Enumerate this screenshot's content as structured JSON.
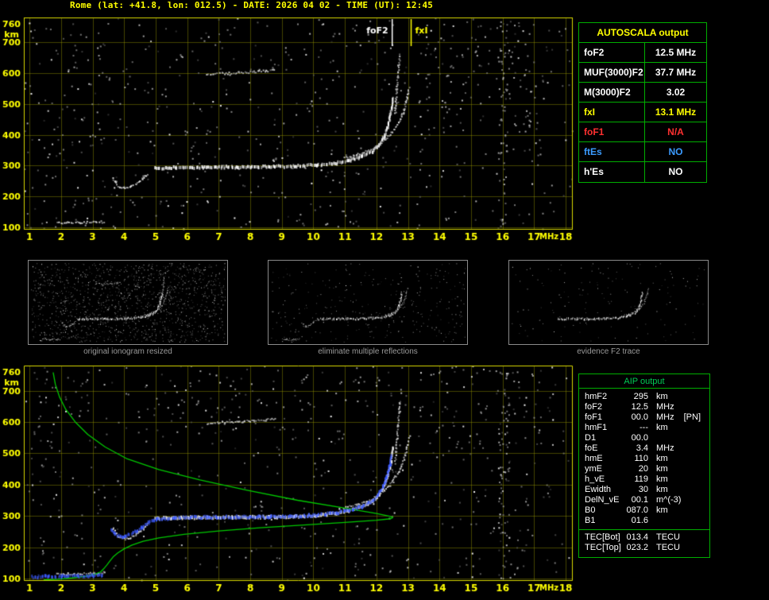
{
  "header": {
    "title": "Rome (lat: +41.8, lon: 012.5) - DATE: 2026 04 02 - TIME (UT): 12:45"
  },
  "autoscala_table": {
    "title": "AUTOSCALA output",
    "rows": [
      {
        "label": "foF2",
        "value": "12.5 MHz",
        "color": "#ffffff"
      },
      {
        "label": "MUF(3000)F2",
        "value": "37.7 MHz",
        "color": "#ffffff"
      },
      {
        "label": "M(3000)F2",
        "value": "3.02",
        "color": "#ffffff"
      },
      {
        "label": "fxI",
        "value": "13.1 MHz",
        "color": "#ffff00"
      },
      {
        "label": "foF1",
        "value": "N/A",
        "color": "#ff3030"
      },
      {
        "label": "ftEs",
        "value": "NO",
        "color": "#3b9bff"
      },
      {
        "label": "h'Es",
        "value": "NO",
        "color": "#ffffff"
      }
    ]
  },
  "thumbnails": [
    {
      "caption": "original ionogram resized",
      "noise": 1400,
      "skip": []
    },
    {
      "caption": "eliminate multiple reflections",
      "noise": 300,
      "skip": [
        "second-hop multiple",
        "foF2 multiple streak"
      ]
    },
    {
      "caption": "evidence F2 trace",
      "noise": 150,
      "skip": [
        "E-region echo",
        "F1 cusp",
        "second-hop multiple",
        "foF2 multiple streak"
      ]
    }
  ],
  "aip_table": {
    "title": "AIP output",
    "rows": [
      {
        "name": "hmF2",
        "value": "295",
        "unit": "km"
      },
      {
        "name": "foF2",
        "value": "12.5",
        "unit": "MHz"
      },
      {
        "name": "foF1",
        "value": "00.0",
        "unit": "MHz",
        "flag": "[PN]"
      },
      {
        "name": "hmF1",
        "value": "---",
        "unit": "km"
      },
      {
        "name": "D1",
        "value": "00.0",
        "unit": ""
      },
      {
        "name": "foE",
        "value": "3.4",
        "unit": "MHz"
      },
      {
        "name": "hmE",
        "value": "110",
        "unit": "km"
      },
      {
        "name": "ymE",
        "value": "20",
        "unit": "km"
      },
      {
        "name": "h_vE",
        "value": "119",
        "unit": "km"
      },
      {
        "name": "Ewidth",
        "value": "30",
        "unit": "km"
      },
      {
        "name": "DelN_vE",
        "value": "00.1",
        "unit": "m^(-3)"
      },
      {
        "name": "B0",
        "value": "087.0",
        "unit": "km"
      },
      {
        "name": "B1",
        "value": "01.6",
        "unit": ""
      }
    ],
    "tec_rows": [
      {
        "name": "TEC[Bot]",
        "value": "013.4",
        "unit": "TECU"
      },
      {
        "name": "TEC[Top]",
        "value": "023.2",
        "unit": "TECU"
      }
    ]
  },
  "chart_data": [
    {
      "type": "scatter",
      "id": "main_ionogram",
      "title": "recorded ionogram",
      "xlabel": "MHz",
      "ylabel": "km",
      "xlim": [
        0.82,
        18.2
      ],
      "ylim": [
        95,
        780
      ],
      "xticks": [
        1,
        2,
        3,
        4,
        5,
        6,
        7,
        8,
        9,
        10,
        11,
        12,
        13,
        14,
        15,
        16,
        17,
        18
      ],
      "yticks": [
        100,
        200,
        300,
        400,
        500,
        600,
        700,
        760
      ],
      "grid": true,
      "annotations": [
        {
          "label": "foF2",
          "freq": 12.5,
          "color": "#ffffff",
          "align": "right"
        },
        {
          "label": "fxI",
          "freq": 13.1,
          "color": "#ffff00",
          "align": "left"
        }
      ],
      "noise": {
        "uniform": 520,
        "clusters": [
          {
            "f": [
              13.3,
              17.6
            ],
            "km": [
              500,
              770
            ],
            "n": 80
          },
          {
            "f": [
              15.85,
              16.15
            ],
            "km": [
              100,
              770
            ],
            "n": 60
          },
          {
            "f": [
              16.3,
              17.2
            ],
            "km": [
              330,
              480
            ],
            "n": 25
          },
          {
            "f": [
              0.9,
              3.5
            ],
            "km": [
              100,
              770
            ],
            "n": 45
          },
          {
            "f": [
              4.0,
              13.0
            ],
            "km": [
              100,
              770
            ],
            "n": 60
          }
        ]
      },
      "series": [
        {
          "name": "E-region echo",
          "color": "#e0e0e0",
          "points": [
            [
              1.85,
              116
            ],
            [
              2.2,
              117
            ],
            [
              2.6,
              118
            ],
            [
              3.0,
              119
            ],
            [
              3.35,
              120
            ]
          ]
        },
        {
          "name": "F1 cusp",
          "color": "#e8e8e8",
          "points": [
            [
              3.62,
              262
            ],
            [
              3.72,
              245
            ],
            [
              3.85,
              233
            ],
            [
              4.0,
              229
            ],
            [
              4.18,
              233
            ],
            [
              4.38,
              244
            ],
            [
              4.58,
              260
            ],
            [
              4.72,
              276
            ]
          ]
        },
        {
          "name": "F2 ordinary trace",
          "color": "#ffffff",
          "thick": true,
          "points": [
            [
              4.95,
              297
            ],
            [
              5.6,
              299
            ],
            [
              6.6,
              300
            ],
            [
              7.6,
              300
            ],
            [
              8.6,
              301
            ],
            [
              9.4,
              303
            ],
            [
              10.1,
              307
            ],
            [
              10.7,
              313
            ],
            [
              11.1,
              321
            ],
            [
              11.5,
              333
            ],
            [
              11.85,
              350
            ],
            [
              12.05,
              370
            ],
            [
              12.2,
              395
            ],
            [
              12.32,
              425
            ],
            [
              12.4,
              458
            ],
            [
              12.46,
              492
            ],
            [
              12.5,
              525
            ]
          ]
        },
        {
          "name": "F2 extraordinary trace",
          "color": "#cfcfcf",
          "points": [
            [
              10.95,
              328
            ],
            [
              11.35,
              337
            ],
            [
              11.7,
              349
            ],
            [
              12.0,
              364
            ],
            [
              12.25,
              384
            ],
            [
              12.5,
              412
            ],
            [
              12.7,
              445
            ],
            [
              12.85,
              482
            ],
            [
              12.95,
              520
            ],
            [
              13.02,
              555
            ]
          ]
        },
        {
          "name": "second-hop multiple",
          "color": "#c8c8c8",
          "points": [
            [
              6.6,
              598
            ],
            [
              7.1,
              601
            ],
            [
              7.6,
              603
            ],
            [
              8.1,
              606
            ],
            [
              8.5,
              609
            ],
            [
              8.75,
              612
            ]
          ]
        },
        {
          "name": "foF2 multiple streak",
          "color": "#c8c8c8",
          "points": [
            [
              12.58,
              470
            ],
            [
              12.6,
              510
            ],
            [
              12.63,
              550
            ],
            [
              12.66,
              590
            ],
            [
              12.69,
              630
            ],
            [
              12.72,
              665
            ]
          ]
        }
      ]
    },
    {
      "type": "scatter",
      "id": "profile_ionogram",
      "title": "ionogram with autoscaled trace and electron density profile",
      "xlabel": "MHz",
      "ylabel": "km",
      "xlim": [
        0.82,
        18.2
      ],
      "ylim": [
        95,
        780
      ],
      "xticks": [
        1,
        2,
        3,
        4,
        5,
        6,
        7,
        8,
        9,
        10,
        11,
        12,
        13,
        14,
        15,
        16,
        17,
        18
      ],
      "yticks": [
        100,
        200,
        300,
        400,
        500,
        600,
        700,
        760
      ],
      "grid": true,
      "include_series_from": "main_ionogram",
      "noise": {
        "uniform": 520,
        "clusters": [
          {
            "f": [
              13.3,
              17.6
            ],
            "km": [
              500,
              770
            ],
            "n": 60
          },
          {
            "f": [
              15.85,
              16.2
            ],
            "km": [
              100,
              770
            ],
            "n": 70
          },
          {
            "f": [
              0.9,
              3.5
            ],
            "km": [
              100,
              770
            ],
            "n": 40
          },
          {
            "f": [
              4.0,
              13.0
            ],
            "km": [
              560,
              770
            ],
            "n": 50
          }
        ]
      },
      "series": [
        {
          "name": "electron density profile",
          "color": "#00c800",
          "style": "line",
          "points": [
            [
              1.75,
              758
            ],
            [
              1.82,
              720
            ],
            [
              1.95,
              680
            ],
            [
              2.15,
              640
            ],
            [
              2.45,
              600
            ],
            [
              2.85,
              560
            ],
            [
              3.4,
              520
            ],
            [
              4.1,
              482
            ],
            [
              5.1,
              448
            ],
            [
              6.4,
              415
            ],
            [
              7.9,
              382
            ],
            [
              9.5,
              350
            ],
            [
              11.0,
              325
            ],
            [
              12.0,
              308
            ],
            [
              12.45,
              298
            ],
            [
              12.52,
              295
            ],
            [
              12.45,
              291
            ],
            [
              12.0,
              286
            ],
            [
              11.0,
              279
            ],
            [
              9.7,
              271
            ],
            [
              8.3,
              262
            ],
            [
              7.0,
              252
            ],
            [
              5.9,
              241
            ],
            [
              5.1,
              230
            ],
            [
              4.6,
              219
            ],
            [
              4.25,
              207
            ],
            [
              4.0,
              195
            ],
            [
              3.8,
              182
            ],
            [
              3.65,
              169
            ],
            [
              3.55,
              156
            ],
            [
              3.45,
              143
            ],
            [
              3.35,
              131
            ],
            [
              3.25,
              121
            ],
            [
              3.05,
              113
            ],
            [
              2.75,
              107
            ],
            [
              2.35,
              102
            ],
            [
              1.9,
              98
            ],
            [
              1.45,
              96
            ]
          ]
        },
        {
          "name": "restored E trace",
          "color": "#3d5bff",
          "thick": true,
          "points": [
            [
              1.05,
              110
            ],
            [
              1.5,
              111
            ],
            [
              2.0,
              112
            ],
            [
              2.5,
              113
            ],
            [
              2.95,
              114
            ],
            [
              3.3,
              115
            ]
          ]
        },
        {
          "name": "restored F trace",
          "color": "#3d5bff",
          "thick": true,
          "points": [
            [
              3.58,
              258
            ],
            [
              3.7,
              246
            ],
            [
              3.85,
              238
            ],
            [
              4.02,
              240
            ],
            [
              4.25,
              250
            ],
            [
              4.5,
              266
            ],
            [
              4.75,
              283
            ],
            [
              5.0,
              294
            ],
            [
              5.6,
              299
            ],
            [
              6.6,
              301
            ],
            [
              7.6,
              302
            ],
            [
              8.6,
              302
            ],
            [
              9.4,
              304
            ],
            [
              10.1,
              308
            ],
            [
              10.7,
              314
            ],
            [
              11.1,
              322
            ],
            [
              11.5,
              334
            ],
            [
              11.85,
              352
            ],
            [
              12.05,
              374
            ],
            [
              12.2,
              400
            ],
            [
              12.32,
              432
            ],
            [
              12.4,
              465
            ],
            [
              12.46,
              498
            ]
          ]
        }
      ]
    }
  ]
}
